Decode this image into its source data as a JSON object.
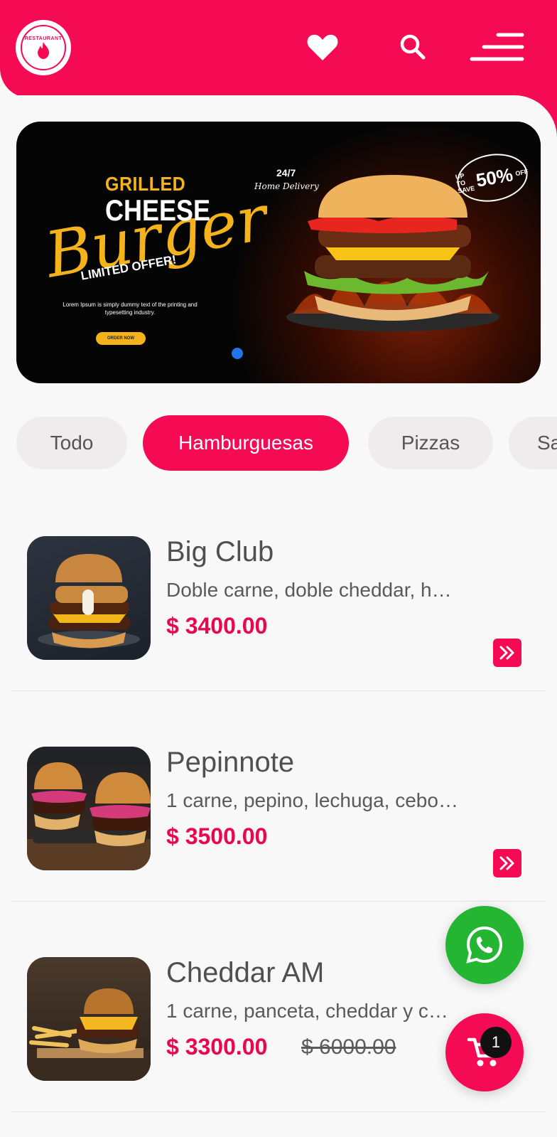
{
  "brand": {
    "accent": "#f50a54",
    "whatsapp": "#24b633",
    "logo_text": "RESTAURANT"
  },
  "header": {
    "favorites_icon": "heart-icon",
    "search_icon": "search-icon",
    "menu_icon": "menu-icon"
  },
  "banner": {
    "grilled": "GRILLED",
    "cheese": "CHEESE",
    "burger": "Burger",
    "limited": "LIMITED OFFER!",
    "lorem": "Lorem Ipsum is simply dummy text of the printing and typesetting industry.",
    "order_now": "ORDER NOW",
    "delivery_247": "24/7",
    "home_delivery": "Home Delivery",
    "badge_up_to": "UP TO",
    "badge_save": "SAVE",
    "badge_percent": "50%",
    "badge_off": "OFF"
  },
  "categories": [
    {
      "label": "Todo",
      "active": false
    },
    {
      "label": "Hamburguesas",
      "active": true
    },
    {
      "label": "Pizzas",
      "active": false
    },
    {
      "label": "Sa",
      "active": false
    }
  ],
  "products": [
    {
      "name": "Big Club",
      "description": "Doble carne, doble cheddar, h…",
      "price": "$ 3400.00"
    },
    {
      "name": "Pepinnote",
      "description": "1 carne, pepino, lechuga, cebo…",
      "price": "$ 3500.00"
    },
    {
      "name": "Cheddar AM",
      "description": "1 carne, panceta, cheddar y c…",
      "price": "$ 3300.00",
      "old_price": "$ 6000.00"
    }
  ],
  "cart": {
    "count": "1"
  }
}
